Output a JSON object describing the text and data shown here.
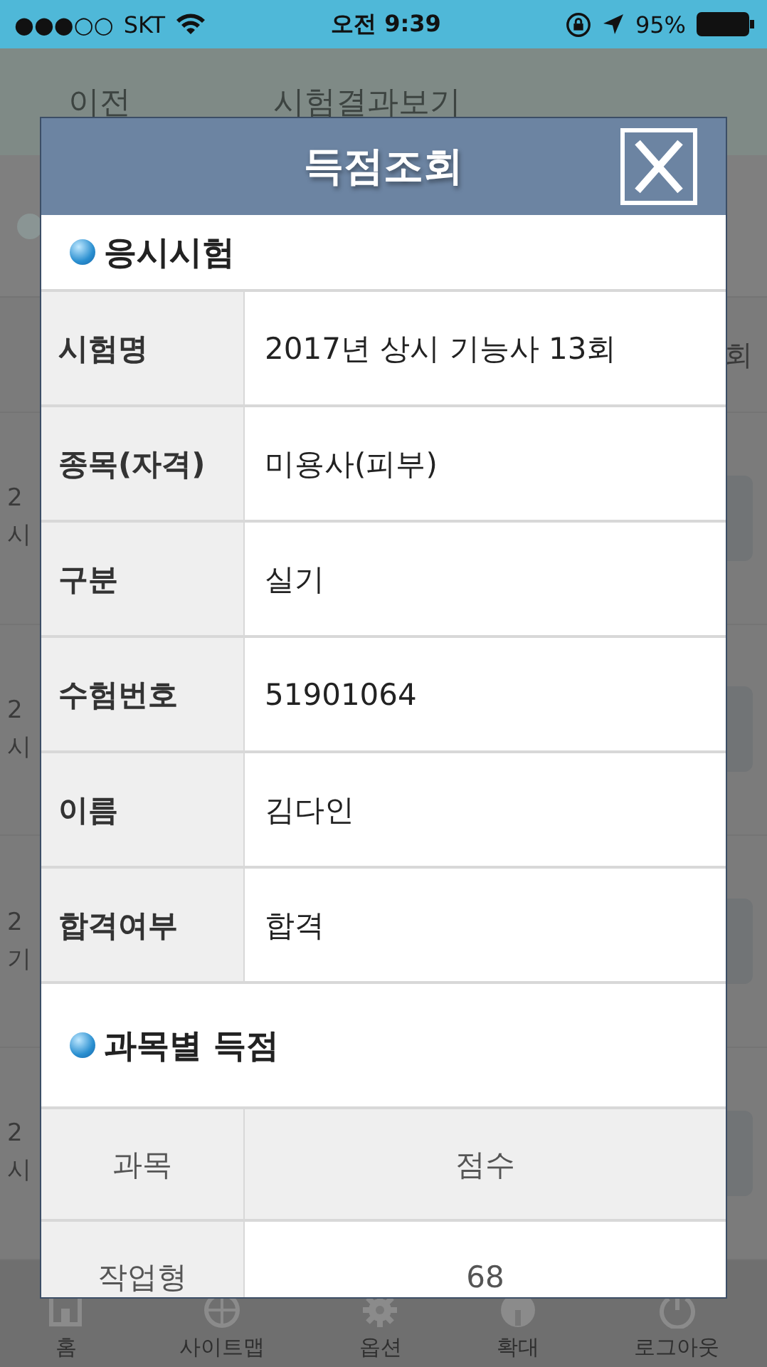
{
  "status_bar": {
    "signal": "●●●○○",
    "carrier": "SKT",
    "time": "오전 9:39",
    "battery": "95%"
  },
  "page": {
    "back": "이전",
    "title": "시험결과보기",
    "header_cell": "회",
    "rows": [
      {
        "line1": "2",
        "line2": "시"
      },
      {
        "line1": "2",
        "line2": "시"
      },
      {
        "line1": "2",
        "line2": "기"
      },
      {
        "line1": "2",
        "line2": "시"
      }
    ]
  },
  "tab_bar": [
    {
      "kind": "home",
      "label": "홈"
    },
    {
      "kind": "sitemap",
      "label": "사이트맵"
    },
    {
      "kind": "options",
      "label": "옵션"
    },
    {
      "kind": "zoom",
      "label": "확대"
    },
    {
      "kind": "logout",
      "label": "로그아웃"
    }
  ],
  "modal": {
    "title": "득점조회",
    "sections": [
      {
        "kind": "info",
        "heading": "응시시험",
        "rows": [
          {
            "label": "시험명",
            "value": "2017년 상시 기능사 13회"
          },
          {
            "label": "종목(자격)",
            "value": "미용사(피부)"
          },
          {
            "label": "구분",
            "value": "실기"
          },
          {
            "label": "수험번호",
            "value": "51901064"
          },
          {
            "label": "이름",
            "value": "김다인"
          },
          {
            "label": "합격여부",
            "value": "합격"
          }
        ]
      },
      {
        "kind": "scores",
        "heading": "과목별 득점",
        "columns": [
          "과목",
          "점수"
        ],
        "rows": [
          [
            "작업형",
            "68"
          ]
        ]
      }
    ]
  }
}
